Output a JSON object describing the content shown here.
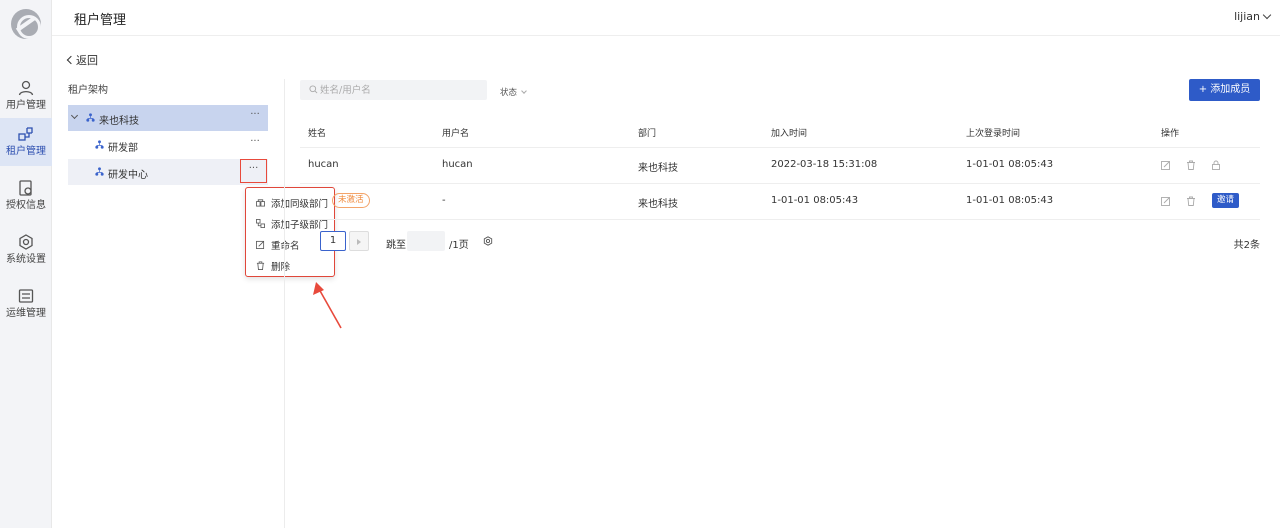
{
  "nav": {
    "items": [
      {
        "label": "用户管理",
        "icon": "user-icon"
      },
      {
        "label": "租户管理",
        "icon": "tenant-icon"
      },
      {
        "label": "授权信息",
        "icon": "license-icon"
      },
      {
        "label": "系统设置",
        "icon": "gear-icon"
      },
      {
        "label": "运维管理",
        "icon": "ops-icon"
      }
    ],
    "active_index": 1
  },
  "header": {
    "title": "租户管理",
    "user": "lijian"
  },
  "back_label": "返回",
  "tree": {
    "title": "租户架构",
    "nodes": [
      {
        "name": "来也科技",
        "level": 0,
        "expanded": true,
        "selected": true
      },
      {
        "name": "研发部",
        "level": 1
      },
      {
        "name": "研发中心",
        "level": 1,
        "hover": true
      }
    ],
    "more_label": "···"
  },
  "context_menu": {
    "items": [
      {
        "label": "添加同级部门",
        "icon": "sibling-dept-icon"
      },
      {
        "label": "添加子级部门",
        "icon": "child-dept-icon"
      },
      {
        "label": "重命名",
        "icon": "edit-icon"
      },
      {
        "label": "删除",
        "icon": "trash-icon"
      }
    ]
  },
  "toolbar": {
    "search_placeholder": "姓名/用户名",
    "status_label": "状态",
    "add_label": "+ 添加成员"
  },
  "table": {
    "columns": [
      "姓名",
      "用户名",
      "部门",
      "加入时间",
      "上次登录时间",
      "操作"
    ],
    "rows": [
      {
        "name": "hucan",
        "username": "hucan",
        "dept": "来也科技",
        "joined": "2022-03-18 15:31:08",
        "last_login": "1-01-01 08:05:43"
      },
      {
        "name": "",
        "badge": "未激活",
        "username": "-",
        "dept": "来也科技",
        "joined": "1-01-01 08:05:43",
        "last_login": "1-01-01 08:05:43",
        "invite": "邀请"
      }
    ]
  },
  "pagination": {
    "current": "1",
    "jump_label": "跳至",
    "page_total": "/1页",
    "total": "共2条"
  },
  "colors": {
    "accent": "#2e5bc8",
    "annotation_red": "#e84a3c",
    "badge_orange": "#f08a3c"
  }
}
